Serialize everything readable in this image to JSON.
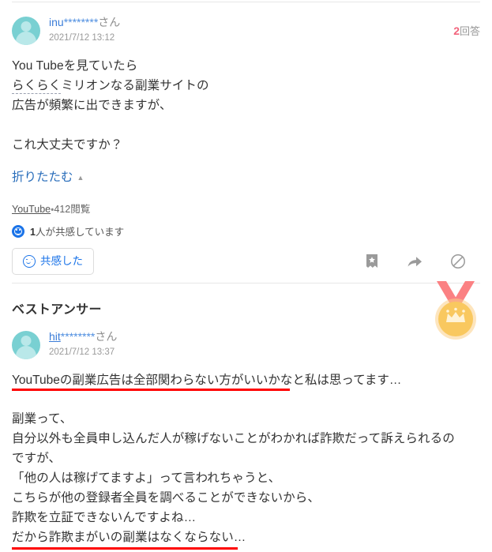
{
  "question": {
    "username": {
      "id": "inu",
      "stars": "********",
      "honorific": "さん"
    },
    "timestamp": "2021/7/12 13:12",
    "answer_count": {
      "number": "2",
      "label": "回答"
    },
    "body_lines": [
      "You Tubeを見ていたら",
      "らくらくミリオンなる副業サイトの",
      "広告が頻繁に出できますが、"
    ],
    "spell_marked_text": "らくらく",
    "body_line2_rest": "ミリオンなる副業サイトの",
    "body_tail": "これ大丈夫ですか？",
    "collapse_label": "折りたたむ",
    "collapse_caret": "▲",
    "source_link": "YouTube",
    "source_separator": "・",
    "views": "412閲覧",
    "empathy_status_count": "1",
    "empathy_status_text": "人が共感しています",
    "empathy_button_label": "共感した",
    "icons": {
      "bookmark": "bookmark-star-icon",
      "share": "share-arrow-icon",
      "block": "block-prohibit-icon"
    }
  },
  "best_answer": {
    "heading": "ベストアンサー",
    "medal_icon": "gold-medal-crown-icon",
    "username": {
      "id": "hit",
      "stars": "********",
      "honorific": "さん"
    },
    "timestamp": "2021/7/12 13:37",
    "lead_line": "YouTubeの副業広告は全部関わらない方がいいかなと私は思ってます…",
    "body_lines": [
      "副業って、",
      "自分以外も全員申し込んだ人が稼げないことがわかれば詐欺だって訴えられるの",
      "ですが、",
      "「他の人は稼げてますよ」って言われちゃうと、",
      "こちらが他の登録者全員を調べることができないから、",
      "詐欺を立証できないんですよね…"
    ],
    "body_last_line": "だから詐欺まがいの副業はなくならない…"
  },
  "colors": {
    "accent_blue": "#1a73e8",
    "link_blue": "#2a6ebb",
    "count_red": "#f2647c",
    "highlight_red": "#ff0000",
    "avatar_teal": "#79d0d2",
    "medal_gold": "#f7c652",
    "medal_ribbon": "#fb8183"
  }
}
